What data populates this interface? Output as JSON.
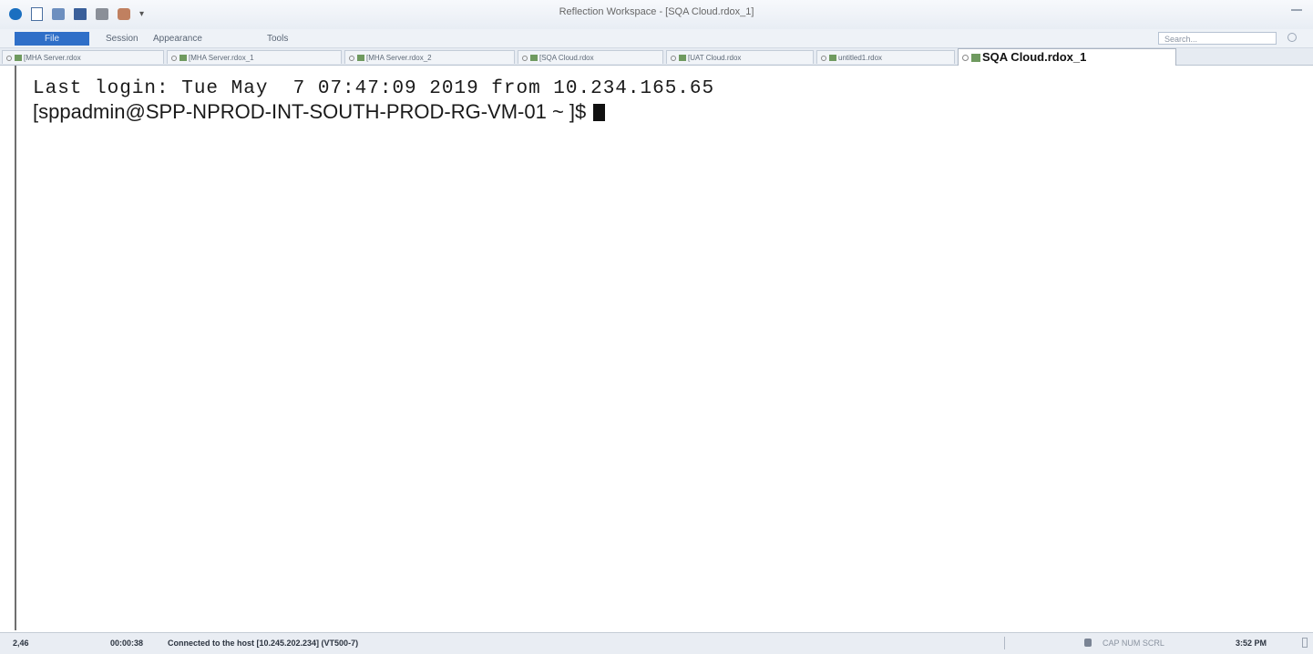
{
  "window": {
    "title": "Reflection Workspace - [SQA Cloud.rdox_1]"
  },
  "quick_access": {
    "icons": [
      "app-icon",
      "new-document-icon",
      "connect-icon",
      "save-icon",
      "print-icon",
      "settings-icon"
    ],
    "more": "▾"
  },
  "ribbon": {
    "tabs": [
      {
        "label": "File"
      },
      {
        "label": "Session"
      },
      {
        "label": "Appearance"
      },
      {
        "label": "Tools"
      }
    ],
    "search_placeholder": "Search..."
  },
  "document_tabs": [
    {
      "label": "[MHA Server.rdox"
    },
    {
      "label": "[MHA Server.rdox_1"
    },
    {
      "label": "[MHA Server.rdox_2"
    },
    {
      "label": "[SQA Cloud.rdox"
    },
    {
      "label": "[UAT Cloud.rdox"
    },
    {
      "label": "untitled1.rdox"
    },
    {
      "label": "SQA Cloud.rdox_1",
      "active": true
    }
  ],
  "terminal": {
    "lines": [
      "Last login: Tue May  7 07:47:09 2019 from 10.234.165.65",
      "[sppadmin@SPP-NPROD-INT-SOUTH-PROD-RG-VM-01 ~ ]$"
    ]
  },
  "status_bar": {
    "cursor_position": "2,46",
    "elapsed": "00:00:38",
    "connection": "Connected to the host [10.245.202.234] (VT500-7)",
    "keys": "CAP  NUM  SCRL",
    "clock": "3:52 PM"
  }
}
